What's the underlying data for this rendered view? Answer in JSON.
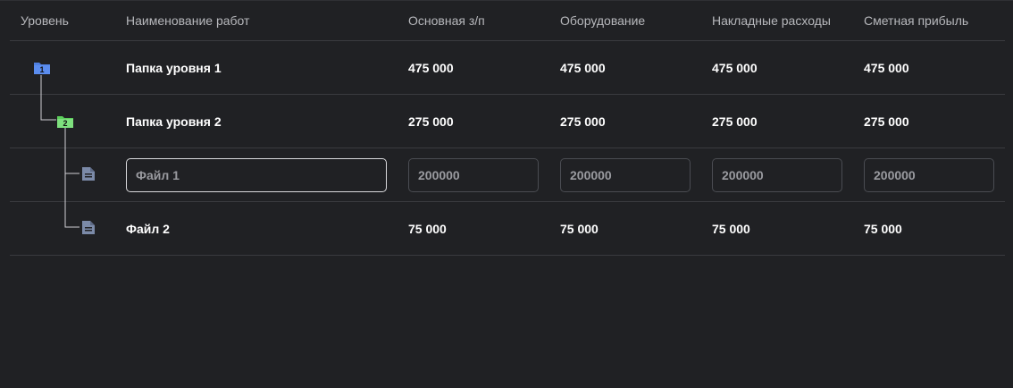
{
  "table": {
    "headers": {
      "level": "Уровень",
      "name": "Наименование работ",
      "salary": "Основная з/п",
      "equipment": "Оборудование",
      "overhead": "Накладные расходы",
      "profit": "Сметная прибыль"
    },
    "rows": [
      {
        "type": "folder",
        "level": "1",
        "name": "Папка уровня 1",
        "salary": "475 000",
        "equipment": "475 000",
        "overhead": "475 000",
        "profit": "475 000"
      },
      {
        "type": "folder",
        "level": "2",
        "name": "Папка уровня 2",
        "salary": "275 000",
        "equipment": "275 000",
        "overhead": "275 000",
        "profit": "275 000"
      },
      {
        "type": "file-edit",
        "name_placeholder": "Файл 1",
        "salary_placeholder": "200000",
        "equipment_placeholder": "200000",
        "overhead_placeholder": "200000",
        "profit_placeholder": "200000"
      },
      {
        "type": "file",
        "name": "Файл 2",
        "salary": "75 000",
        "equipment": "75 000",
        "overhead": "75 000",
        "profit": "75 000"
      }
    ]
  },
  "colors": {
    "background": "#202124",
    "folder_level_1": "#5b8def",
    "folder_level_2": "#7ee07e",
    "file_icon": "#7b8aa8",
    "divider": "#3a3b3f"
  },
  "icons": {
    "folder": "folder-icon",
    "file": "file-document-icon"
  }
}
